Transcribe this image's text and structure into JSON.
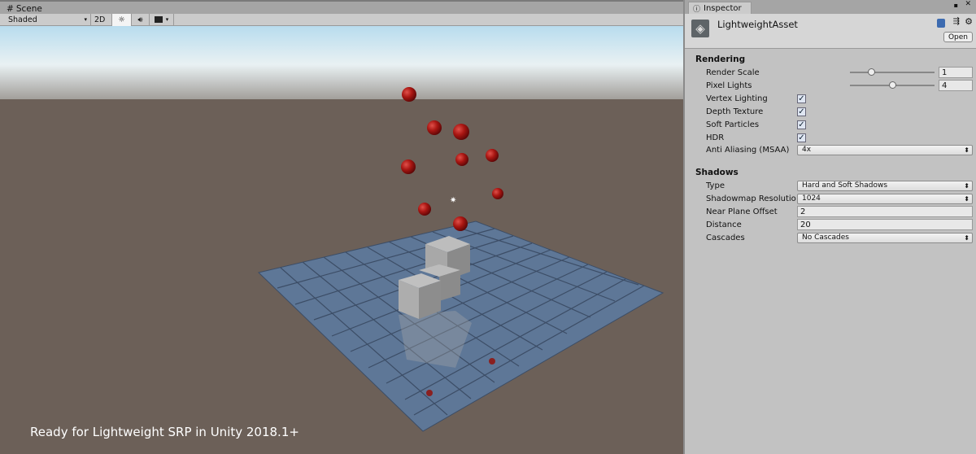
{
  "scene": {
    "tab_label": "Scene",
    "shading_mode": "Shaded",
    "btn_2d": "2D",
    "caption": "Ready for Lightweight SRP in Unity  2018.1+"
  },
  "inspector": {
    "tab_label": "Inspector",
    "asset_name": "LightweightAsset",
    "open_label": "Open",
    "rendering": {
      "title": "Rendering",
      "render_scale": {
        "label": "Render Scale",
        "value": "1",
        "fraction": 0.25
      },
      "pixel_lights": {
        "label": "Pixel Lights",
        "value": "4",
        "fraction": 0.5
      },
      "vertex_lighting": {
        "label": "Vertex Lighting",
        "checked": true
      },
      "depth_texture": {
        "label": "Depth Texture",
        "checked": true
      },
      "soft_particles": {
        "label": "Soft Particles",
        "checked": true
      },
      "hdr": {
        "label": "HDR",
        "checked": true
      },
      "anti_aliasing": {
        "label": "Anti Aliasing (MSAA)",
        "value": "4x"
      }
    },
    "shadows": {
      "title": "Shadows",
      "type": {
        "label": "Type",
        "value": "Hard and Soft Shadows"
      },
      "resolution": {
        "label": "Shadowmap Resolutio",
        "value": "1024"
      },
      "near_plane": {
        "label": "Near Plane Offset",
        "value": "2"
      },
      "distance": {
        "label": "Distance",
        "value": "20"
      },
      "cascades": {
        "label": "Cascades",
        "value": "No Cascades"
      }
    }
  }
}
